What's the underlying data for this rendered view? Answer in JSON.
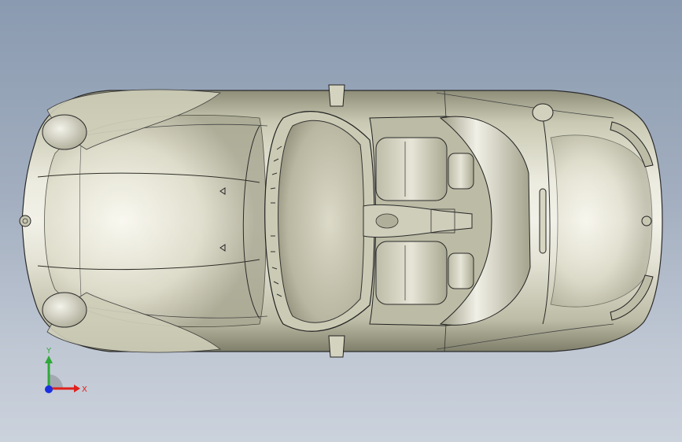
{
  "viewport": {
    "background_top": "#8a9ab0",
    "background_bottom": "#cbd2dc",
    "model_color": "#d9d9c6",
    "edge_color": "#2b2b2b"
  },
  "triad": {
    "x_label": "X",
    "y_label": "Y",
    "x_color": "#e0201a",
    "y_color": "#2fa83a",
    "z_color": "#1a2fe0"
  }
}
